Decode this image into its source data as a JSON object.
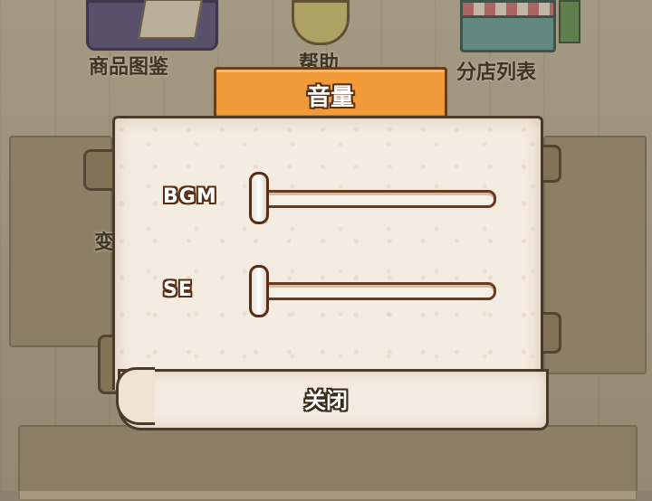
{
  "background": {
    "menu_items": [
      {
        "label": "商品图鉴",
        "icon": "catalog-book-icon"
      },
      {
        "label": "帮助",
        "icon": "lightbulb-icon"
      },
      {
        "label": "分店列表",
        "icon": "shop-icon"
      }
    ],
    "partial_label": "变"
  },
  "dialog": {
    "title": "音量",
    "bgm": {
      "label": "BGM",
      "level": 0.0
    },
    "se": {
      "label": "SE",
      "level": 0.0
    },
    "close_label": "关闭"
  },
  "colors": {
    "title_tab": "#f09a3a",
    "panel": "#f4ece0",
    "outline": "#4a3a2a"
  }
}
